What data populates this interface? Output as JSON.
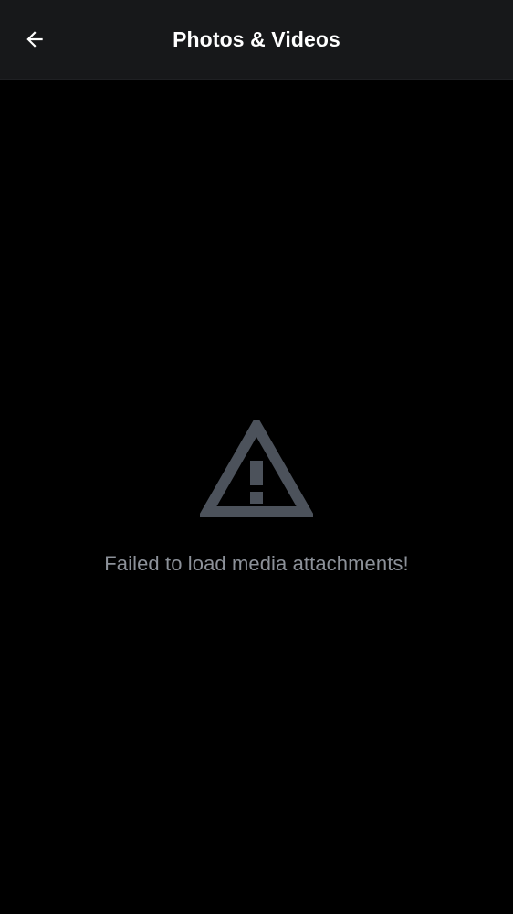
{
  "header": {
    "title": "Photos & Videos",
    "back_icon": "arrow-left-icon"
  },
  "empty_state": {
    "icon": "warning-icon",
    "message": "Failed to load media attachments!"
  },
  "colors": {
    "background": "#000000",
    "header_background": "#17181a",
    "title_text": "#ffffff",
    "icon_color": "#4c525b",
    "message_text": "#8c9199"
  }
}
